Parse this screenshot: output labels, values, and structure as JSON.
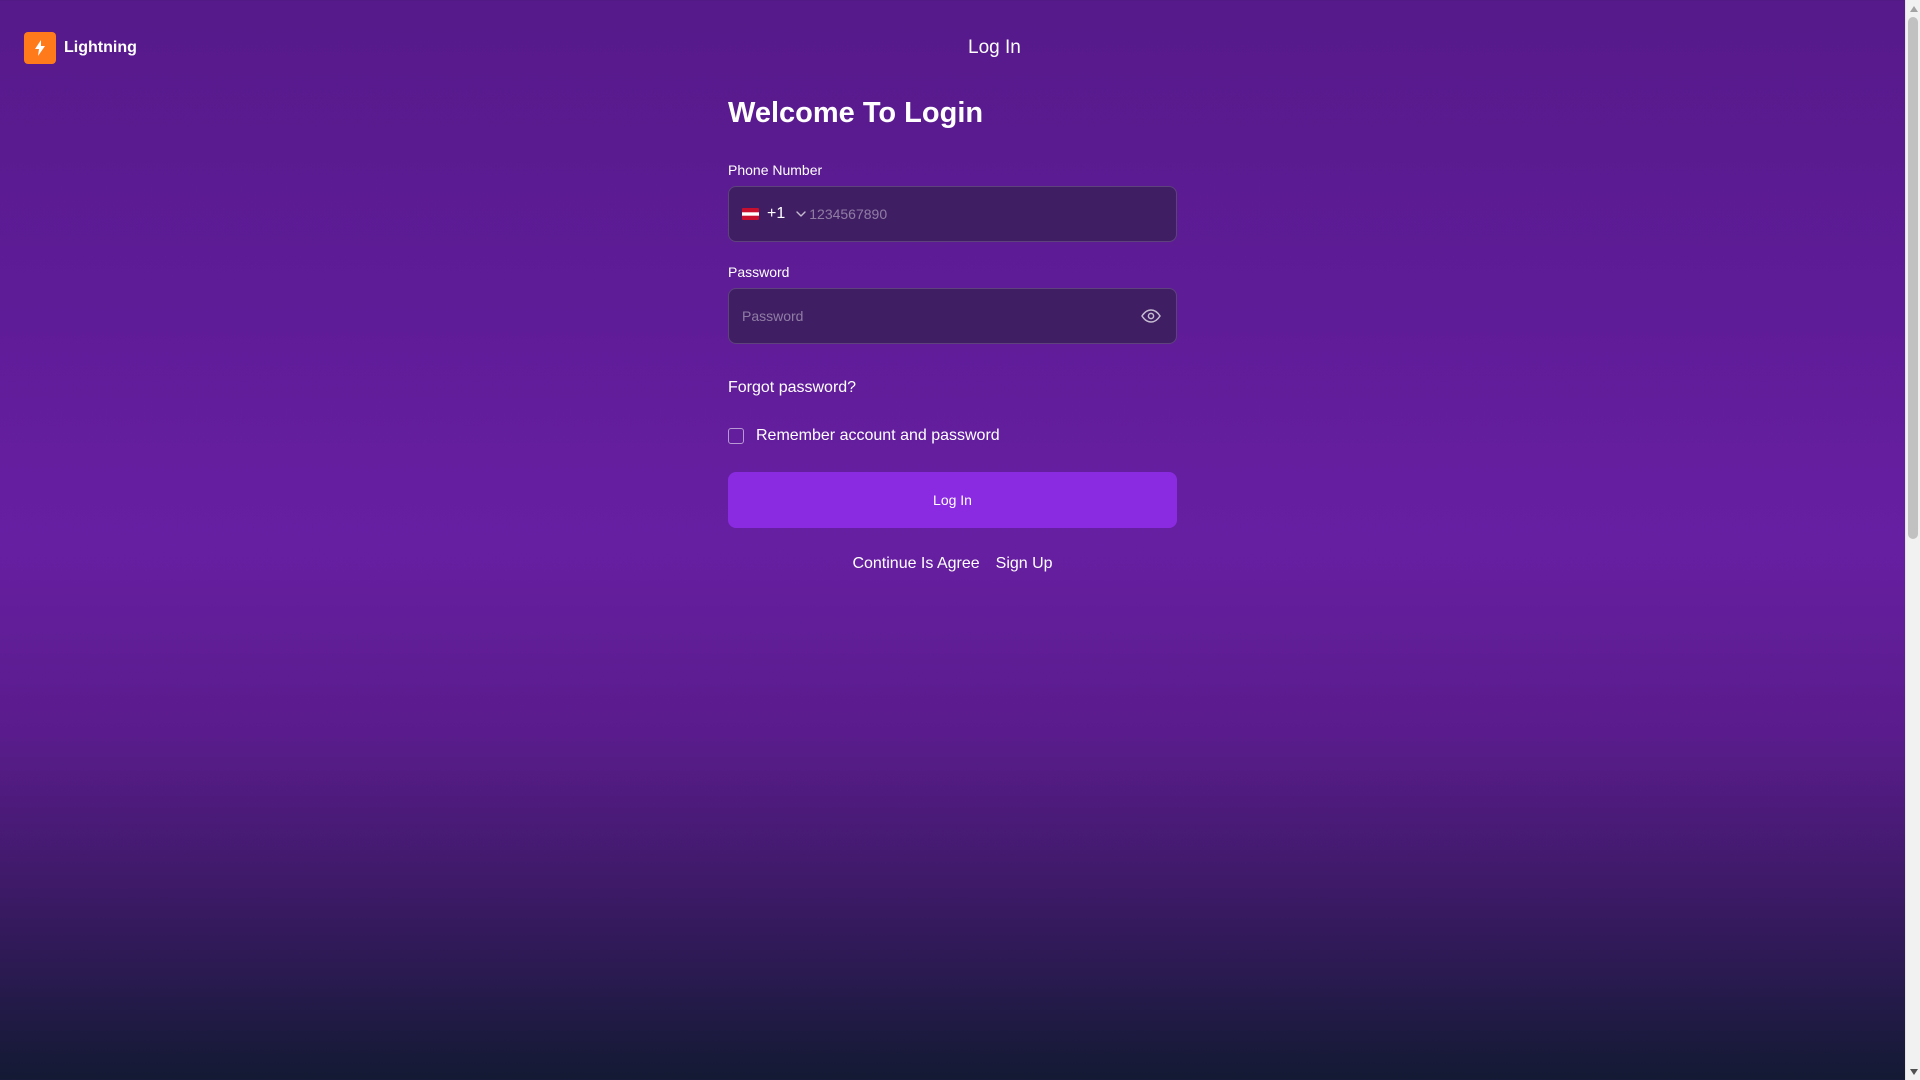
{
  "header": {
    "brand_name": "Lightning",
    "brand_icon": "lightning-icon",
    "title": "Log In"
  },
  "form": {
    "title": "Welcome To Login",
    "phone": {
      "label": "Phone Number",
      "country_code": "+1",
      "country_flag_icon": "flag-icon",
      "placeholder": "1234567890",
      "value": ""
    },
    "password": {
      "label": "Password",
      "placeholder": "Password",
      "value": "",
      "toggle_icon": "eye-icon"
    },
    "forgot_link": "Forgot password?",
    "remember": {
      "label": "Remember account and password",
      "checked": false
    },
    "submit_label": "Log In",
    "agreement_text": "Continue Is Agree",
    "signup_link": "Sign Up"
  },
  "colors": {
    "brand_orange": "#ff7a1a",
    "button_purple": "#8a2be2",
    "bg_top": "#561a8a",
    "bg_bottom": "#131a33"
  }
}
